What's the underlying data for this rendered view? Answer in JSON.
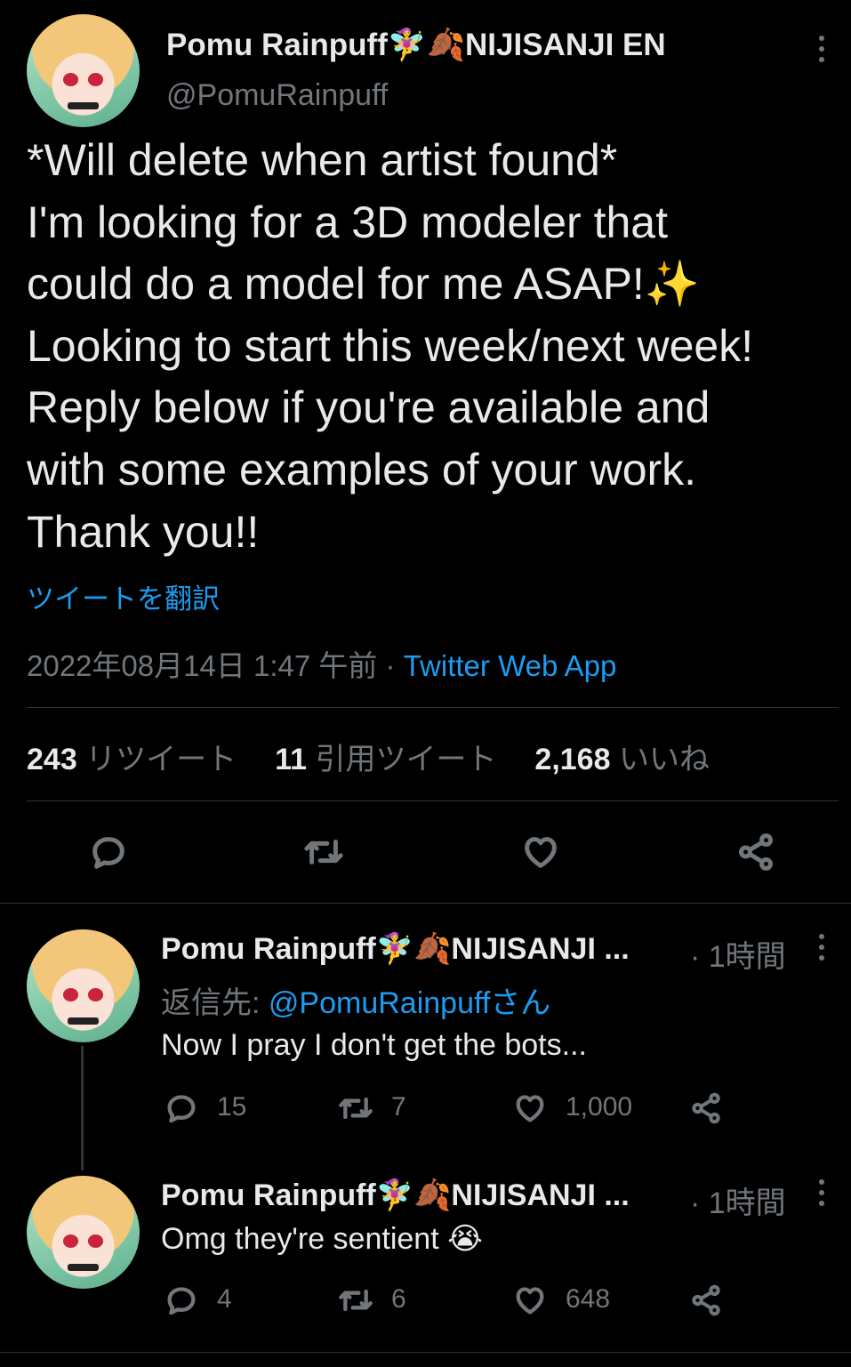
{
  "main_tweet": {
    "display_name": "Pomu Rainpuff🧚‍♀️🍂NIJISANJI EN",
    "handle": "@PomuRainpuff",
    "text": "*Will delete when artist found*\nI'm looking for a 3D modeler that\ncould do a model for me ASAP!✨\nLooking to start this week/next week!\nReply below if you're available and\nwith some examples of your work.\nThank you!!",
    "translate_label": "ツイートを翻訳",
    "timestamp": "2022年08月14日 1:47 午前",
    "separator": " · ",
    "source": "Twitter Web App",
    "stats": {
      "retweets_count": "243",
      "retweets_label": "リツイート",
      "quotes_count": "11",
      "quotes_label": "引用ツイート",
      "likes_count": "2,168",
      "likes_label": "いいね"
    }
  },
  "replies": [
    {
      "display_name": "Pomu Rainpuff🧚‍♀️🍂NIJISANJI ...",
      "time": "· 1時間",
      "reply_to_prefix": "返信先: ",
      "reply_to_handle": "@PomuRainpuffさん",
      "text": "Now I pray I don't get the bots...",
      "reply_count": "15",
      "retweet_count": "7",
      "like_count": "1,000"
    },
    {
      "display_name": "Pomu Rainpuff🧚‍♀️🍂NIJISANJI ...",
      "time": "· 1時間",
      "text": "Omg they're sentient 😭",
      "reply_count": "4",
      "retweet_count": "6",
      "like_count": "648"
    }
  ],
  "colors": {
    "background": "#000000",
    "text": "#e7e9ea",
    "muted": "#71767b",
    "accent": "#1d9bf0",
    "divider": "#2f3336"
  },
  "icons": [
    "more-icon",
    "reply-icon",
    "retweet-icon",
    "like-icon",
    "share-icon"
  ]
}
